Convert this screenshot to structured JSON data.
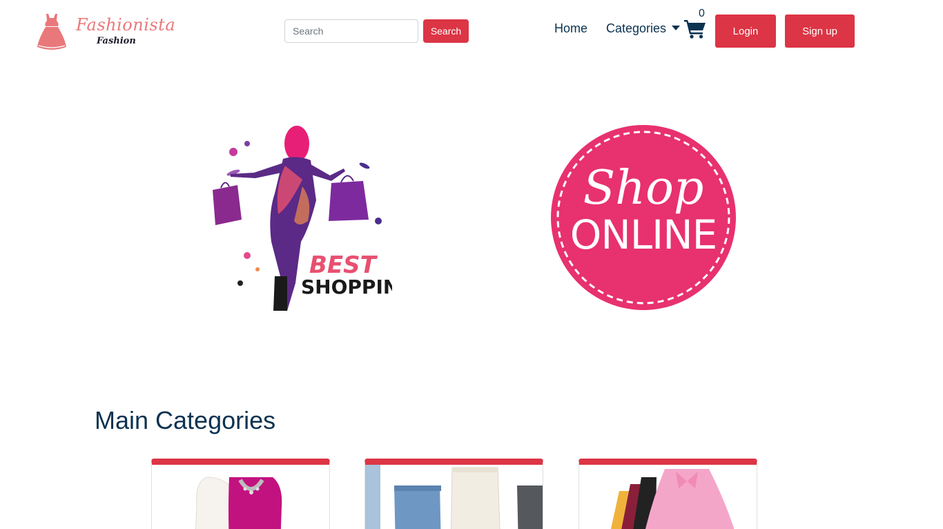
{
  "brand": {
    "name": "Fashionista",
    "tagline": "Fashion"
  },
  "search": {
    "placeholder": "Search",
    "button_label": "Search"
  },
  "nav": {
    "home": "Home",
    "categories": "Categories",
    "cart_count": "0"
  },
  "auth": {
    "login_label": "Login",
    "signup_label": "Sign up"
  },
  "hero": {
    "left_image_text": "BEST SHOPPING",
    "right_image_text_script": "Shop",
    "right_image_text_caps": "ONLINE"
  },
  "main": {
    "section_title": "Main Categories",
    "categories": [
      {
        "icon": "dress-blazer-image"
      },
      {
        "icon": "jeans-image"
      },
      {
        "icon": "skirts-image"
      }
    ]
  },
  "colors": {
    "accent": "#dc3545",
    "text_primary": "#0b3250",
    "logo": "#e9787b",
    "pink_badge": "#e8316f"
  }
}
